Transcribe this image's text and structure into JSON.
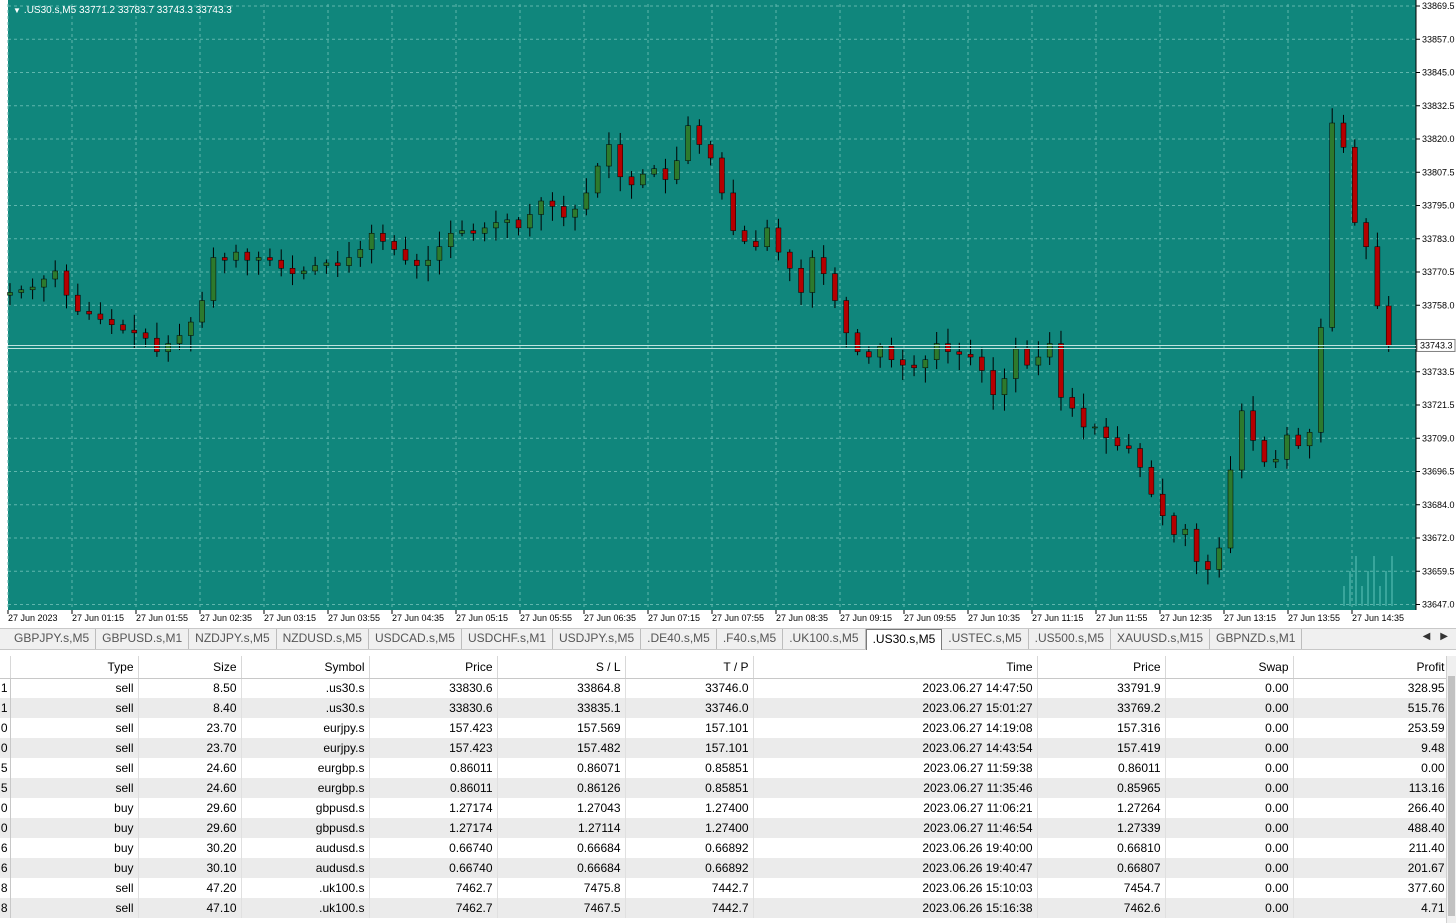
{
  "chart": {
    "header": ".US30.s,M5   33771.2 33783.7 33743.3 33743.3",
    "current_price_label": "33743.3",
    "colors": {
      "background": "#10867c",
      "grid": "#5fb6ad",
      "bull": "#2d7a2d",
      "bear": "#b50000",
      "wick": "#000000",
      "axis_bg": "#ffffff",
      "axis_text": "#000000"
    },
    "y_ticks": [
      "33869.5",
      "33857.0",
      "33845.0",
      "33832.5",
      "33820.0",
      "33807.5",
      "33795.0",
      "33783.0",
      "33770.5",
      "33758.0",
      "33733.5",
      "33721.5",
      "33709.0",
      "33696.5",
      "33684.0",
      "33672.0",
      "33659.5",
      "33647.0"
    ],
    "x_ticks": [
      "27 Jun 2023",
      "27 Jun 01:15",
      "27 Jun 01:55",
      "27 Jun 02:35",
      "27 Jun 03:15",
      "27 Jun 03:55",
      "27 Jun 04:35",
      "27 Jun 05:15",
      "27 Jun 05:55",
      "27 Jun 06:35",
      "27 Jun 07:15",
      "27 Jun 07:55",
      "27 Jun 08:35",
      "27 Jun 09:15",
      "27 Jun 09:55",
      "27 Jun 10:35",
      "27 Jun 11:15",
      "27 Jun 11:55",
      "27 Jun 12:35",
      "27 Jun 13:15",
      "27 Jun 13:55",
      "27 Jun 14:35"
    ]
  },
  "chart_data": {
    "type": "candlestick",
    "symbol": ".US30.s",
    "timeframe": "M5",
    "ylim": [
      33647.0,
      33869.5
    ],
    "x_start": "27 Jun 2023 00:35",
    "close_path": [
      33763,
      33764,
      33765,
      33768,
      33771,
      33762,
      33756,
      33755,
      33753,
      33751,
      33749,
      33748,
      33746,
      33741,
      33744,
      33747,
      33752,
      33760,
      33776,
      33775,
      33778,
      33775,
      33776,
      33775,
      33772,
      33770,
      33771,
      33773,
      33774,
      33773,
      33776,
      33779,
      33785,
      33782,
      33779,
      33775,
      33773,
      33775,
      33780,
      33785,
      33786,
      33785,
      33787,
      33789,
      33790,
      33787,
      33792,
      33797,
      33795,
      33791,
      33794,
      33800,
      33810,
      33818,
      33806,
      33803,
      33807,
      33809,
      33805,
      33812,
      33825,
      33818,
      33813,
      33800,
      33786,
      33782,
      33780,
      33787,
      33778,
      33772,
      33763,
      33776,
      33770,
      33760,
      33748,
      33741,
      33739,
      33743,
      33738,
      33736,
      33735,
      33738,
      33744,
      33741,
      33740,
      33739,
      33734,
      33725,
      33731,
      33742,
      33736,
      33739,
      33744,
      33724,
      33720,
      33713,
      33713,
      33709,
      33706,
      33705,
      33698,
      33688,
      33680,
      33673,
      33675,
      33663,
      33660,
      33668,
      33697,
      33719,
      33708,
      33700,
      33701,
      33710,
      33706,
      33711,
      33750,
      33826,
      33817,
      33789,
      33780,
      33758,
      33743.3
    ]
  },
  "tabs": [
    "GBPJPY.s,M5",
    "GBPUSD.s,M1",
    "NZDJPY.s,M5",
    "NZDUSD.s,M5",
    "USDCAD.s,M5",
    "USDCHF.s,M1",
    "USDJPY.s,M5",
    ".DE40.s,M5",
    ".F40.s,M5",
    ".UK100.s,M5",
    ".US30.s,M5",
    ".USTEC.s,M5",
    ".US500.s,M5",
    "XAUUSD.s,M15",
    "GBPNZD.s,M1"
  ],
  "active_tab_index": 10,
  "table": {
    "headers": [
      "",
      "Type",
      "Size",
      "Symbol",
      "Price",
      "S / L",
      "T / P",
      "Time",
      "Price",
      "Swap",
      "Profit"
    ],
    "rows": [
      [
        "1",
        "sell",
        "8.50",
        ".us30.s",
        "33830.6",
        "33864.8",
        "33746.0",
        "2023.06.27 14:47:50",
        "33791.9",
        "0.00",
        "328.95"
      ],
      [
        "1",
        "sell",
        "8.40",
        ".us30.s",
        "33830.6",
        "33835.1",
        "33746.0",
        "2023.06.27 15:01:27",
        "33769.2",
        "0.00",
        "515.76"
      ],
      [
        "0",
        "sell",
        "23.70",
        "eurjpy.s",
        "157.423",
        "157.569",
        "157.101",
        "2023.06.27 14:19:08",
        "157.316",
        "0.00",
        "253.59"
      ],
      [
        "0",
        "sell",
        "23.70",
        "eurjpy.s",
        "157.423",
        "157.482",
        "157.101",
        "2023.06.27 14:43:54",
        "157.419",
        "0.00",
        "9.48"
      ],
      [
        "5",
        "sell",
        "24.60",
        "eurgbp.s",
        "0.86011",
        "0.86071",
        "0.85851",
        "2023.06.27 11:59:38",
        "0.86011",
        "0.00",
        "0.00"
      ],
      [
        "5",
        "sell",
        "24.60",
        "eurgbp.s",
        "0.86011",
        "0.86126",
        "0.85851",
        "2023.06.27 11:35:46",
        "0.85965",
        "0.00",
        "113.16"
      ],
      [
        "0",
        "buy",
        "29.60",
        "gbpusd.s",
        "1.27174",
        "1.27043",
        "1.27400",
        "2023.06.27 11:06:21",
        "1.27264",
        "0.00",
        "266.40"
      ],
      [
        "0",
        "buy",
        "29.60",
        "gbpusd.s",
        "1.27174",
        "1.27114",
        "1.27400",
        "2023.06.27 11:46:54",
        "1.27339",
        "0.00",
        "488.40"
      ],
      [
        "6",
        "buy",
        "30.20",
        "audusd.s",
        "0.66740",
        "0.66684",
        "0.66892",
        "2023.06.26 19:40:00",
        "0.66810",
        "0.00",
        "211.40"
      ],
      [
        "6",
        "buy",
        "30.10",
        "audusd.s",
        "0.66740",
        "0.66684",
        "0.66892",
        "2023.06.26 19:40:47",
        "0.66807",
        "0.00",
        "201.67"
      ],
      [
        "8",
        "sell",
        "47.20",
        ".uk100.s",
        "7462.7",
        "7475.8",
        "7442.7",
        "2023.06.26 15:10:03",
        "7454.7",
        "0.00",
        "377.60"
      ],
      [
        "8",
        "sell",
        "47.10",
        ".uk100.s",
        "7462.7",
        "7467.5",
        "7442.7",
        "2023.06.26 15:16:38",
        "7462.6",
        "0.00",
        "4.71"
      ]
    ]
  }
}
